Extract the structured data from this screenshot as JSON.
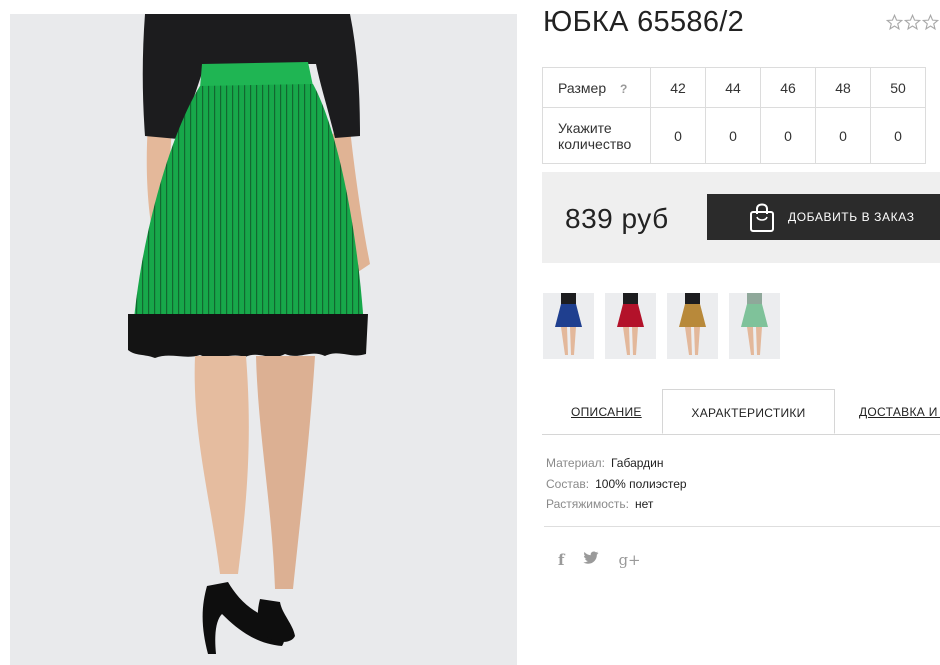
{
  "product": {
    "title": "ЮБКА 65586/2",
    "rating_stars": 3
  },
  "size_table": {
    "size_label": "Размер",
    "help_icon": "?",
    "sizes": [
      "42",
      "44",
      "46",
      "48",
      "50"
    ],
    "quantity_label_line1": "Укажите",
    "quantity_label_line2": "количество",
    "quantities": [
      "0",
      "0",
      "0",
      "0",
      "0"
    ]
  },
  "price": {
    "value": "839 руб",
    "add_to_cart_label": "ДОБАВИТЬ В ЗАКАЗ",
    "button_color": "#2b2b2b"
  },
  "color_variants": [
    {
      "name": "blue",
      "color": "#1f3f8f"
    },
    {
      "name": "red",
      "color": "#b3122a"
    },
    {
      "name": "gold",
      "color": "#b8893a"
    },
    {
      "name": "mint",
      "color": "#7fc29a"
    }
  ],
  "tabs": [
    {
      "label": "ОПИСАНИЕ"
    },
    {
      "label": "ХАРАКТЕРИСТИКИ"
    },
    {
      "label": "ДОСТАВКА И О"
    }
  ],
  "specs": [
    {
      "key": "Материал:",
      "value": "Габардин"
    },
    {
      "key": "Состав:",
      "value": "100% полиэстер"
    },
    {
      "key": "Растяжимость:",
      "value": "нет"
    }
  ],
  "social": {
    "facebook": "f",
    "twitter": "twitter-icon",
    "google_plus": "g+"
  },
  "photo": {
    "skirt_color": "#17a84a"
  }
}
